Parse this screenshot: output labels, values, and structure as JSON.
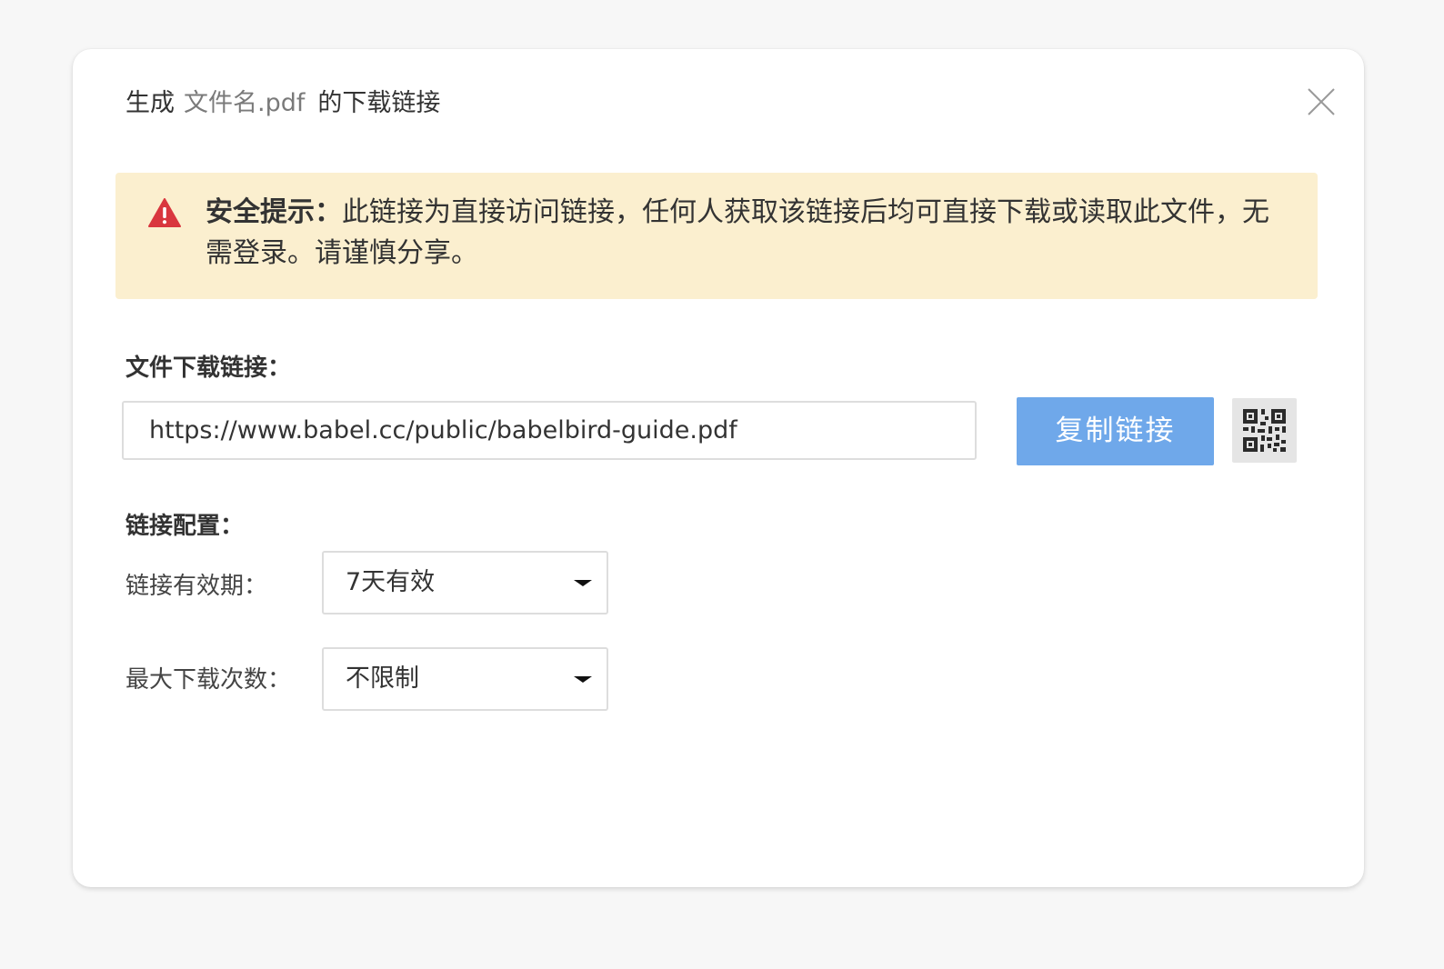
{
  "dialog": {
    "title_prefix": "生成",
    "title_filename": "文件名.pdf",
    "title_suffix": "的下载链接",
    "close_icon": "close-icon"
  },
  "warning": {
    "icon": "warning-triangle-icon",
    "label": "安全提示：",
    "message": "此链接为直接访问链接，任何人获取该链接后均可直接下载或读取此文件，无需登录。请谨慎分享。",
    "background_color": "#fbefcf",
    "icon_color": "#d9363e"
  },
  "download_link": {
    "label": "文件下载链接：",
    "url": "https://www.babel.cc/public/babelbird-guide.pdf",
    "copy_button_label": "复制链接",
    "copy_button_color": "#6fa8ea",
    "qr_icon": "qr-code-icon"
  },
  "config": {
    "label": "链接配置：",
    "expiry": {
      "label": "链接有效期：",
      "value": "7天有效"
    },
    "max_downloads": {
      "label": "最大下载次数：",
      "value": "不限制"
    }
  }
}
